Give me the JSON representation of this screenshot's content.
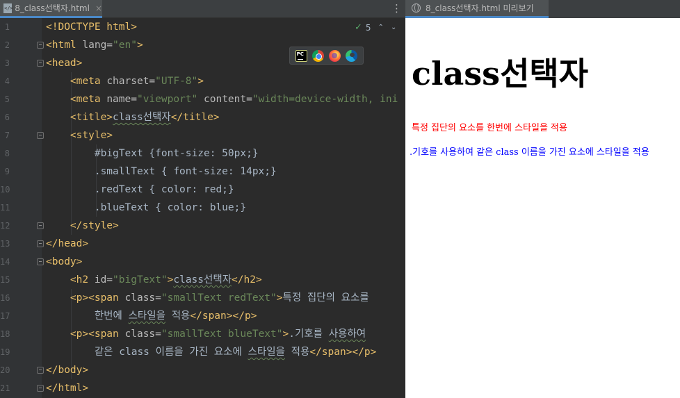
{
  "editor": {
    "tab_label": "8_class선택자.html",
    "tab_close": "×",
    "menu": "⋮",
    "inspection_count": "5",
    "browsers": [
      "pycharm-icon",
      "chrome-icon",
      "firefox-icon",
      "edge-icon"
    ],
    "line_numbers": [
      "1",
      "2",
      "3",
      "4",
      "5",
      "6",
      "7",
      "8",
      "9",
      "10",
      "11",
      "12",
      "13",
      "14",
      "15",
      "16",
      "17",
      "18",
      "19",
      "20",
      "21"
    ],
    "code": {
      "l1": "<!DOCTYPE html>",
      "l2_open": "<html ",
      "l2_attr": "lang=",
      "l2_val": "\"en\"",
      "l2_close": ">",
      "l3": "<head>",
      "l4_open": "<meta ",
      "l4_attr": "charset=",
      "l4_val": "\"UTF-8\"",
      "l4_close": ">",
      "l5_open": "<meta ",
      "l5_attr1": "name=",
      "l5_val1": "\"viewport\"",
      "l5_attr2": " content=",
      "l5_val2": "\"width=device-width, ini",
      "l6_open": "<title>",
      "l6_text": "class선택자",
      "l6_close": "</title>",
      "l7": "<style>",
      "l8": "#bigText {font-size: 50px;}",
      "l9": ".smallText { font-size: 14px;}",
      "l10": ".redText { color: red;}",
      "l11": ".blueText { color: blue;}",
      "l12": "</style>",
      "l13": "</head>",
      "l14": "<body>",
      "l15_open": "<h2 ",
      "l15_attr": "id=",
      "l15_val": "\"bigText\"",
      "l15_gt": ">",
      "l15_text": "class선택자",
      "l15_close": "</h2>",
      "l16_open": "<p><span ",
      "l16_attr": "class=",
      "l16_val": "\"smallText redText\"",
      "l16_gt": ">",
      "l16_text": "특정 집단의 요소를",
      "l17_text1": "한번에 ",
      "l17_text2": "스타일을",
      "l17_text3": " 적용",
      "l17_close": "</span></p>",
      "l18_open": "<p><span ",
      "l18_attr": "class=",
      "l18_val": "\"smallText blueText\"",
      "l18_gt": ">",
      "l18_text1": ".기호를 ",
      "l18_text2": "사용하여",
      "l19_text1": "같은 class 이름을 가진 요소에 ",
      "l19_text2": "스타일을",
      "l19_text3": " 적용",
      "l19_close": "</span></p>",
      "l20": "</body>",
      "l21": "</html>"
    }
  },
  "preview": {
    "tab_label": "8_class선택자.html 미리보기",
    "heading": "class선택자",
    "red_text": "특정 집단의 요소를 한번에 스타일을 적용",
    "blue_text": ".기호를 사용하여 같은 class 이름을 가진 요소에 스타일을 적용",
    "colors": {
      "red": "#ff0000",
      "blue": "#0000ff",
      "tag": "#e8bf6a",
      "string": "#6a8759"
    }
  }
}
